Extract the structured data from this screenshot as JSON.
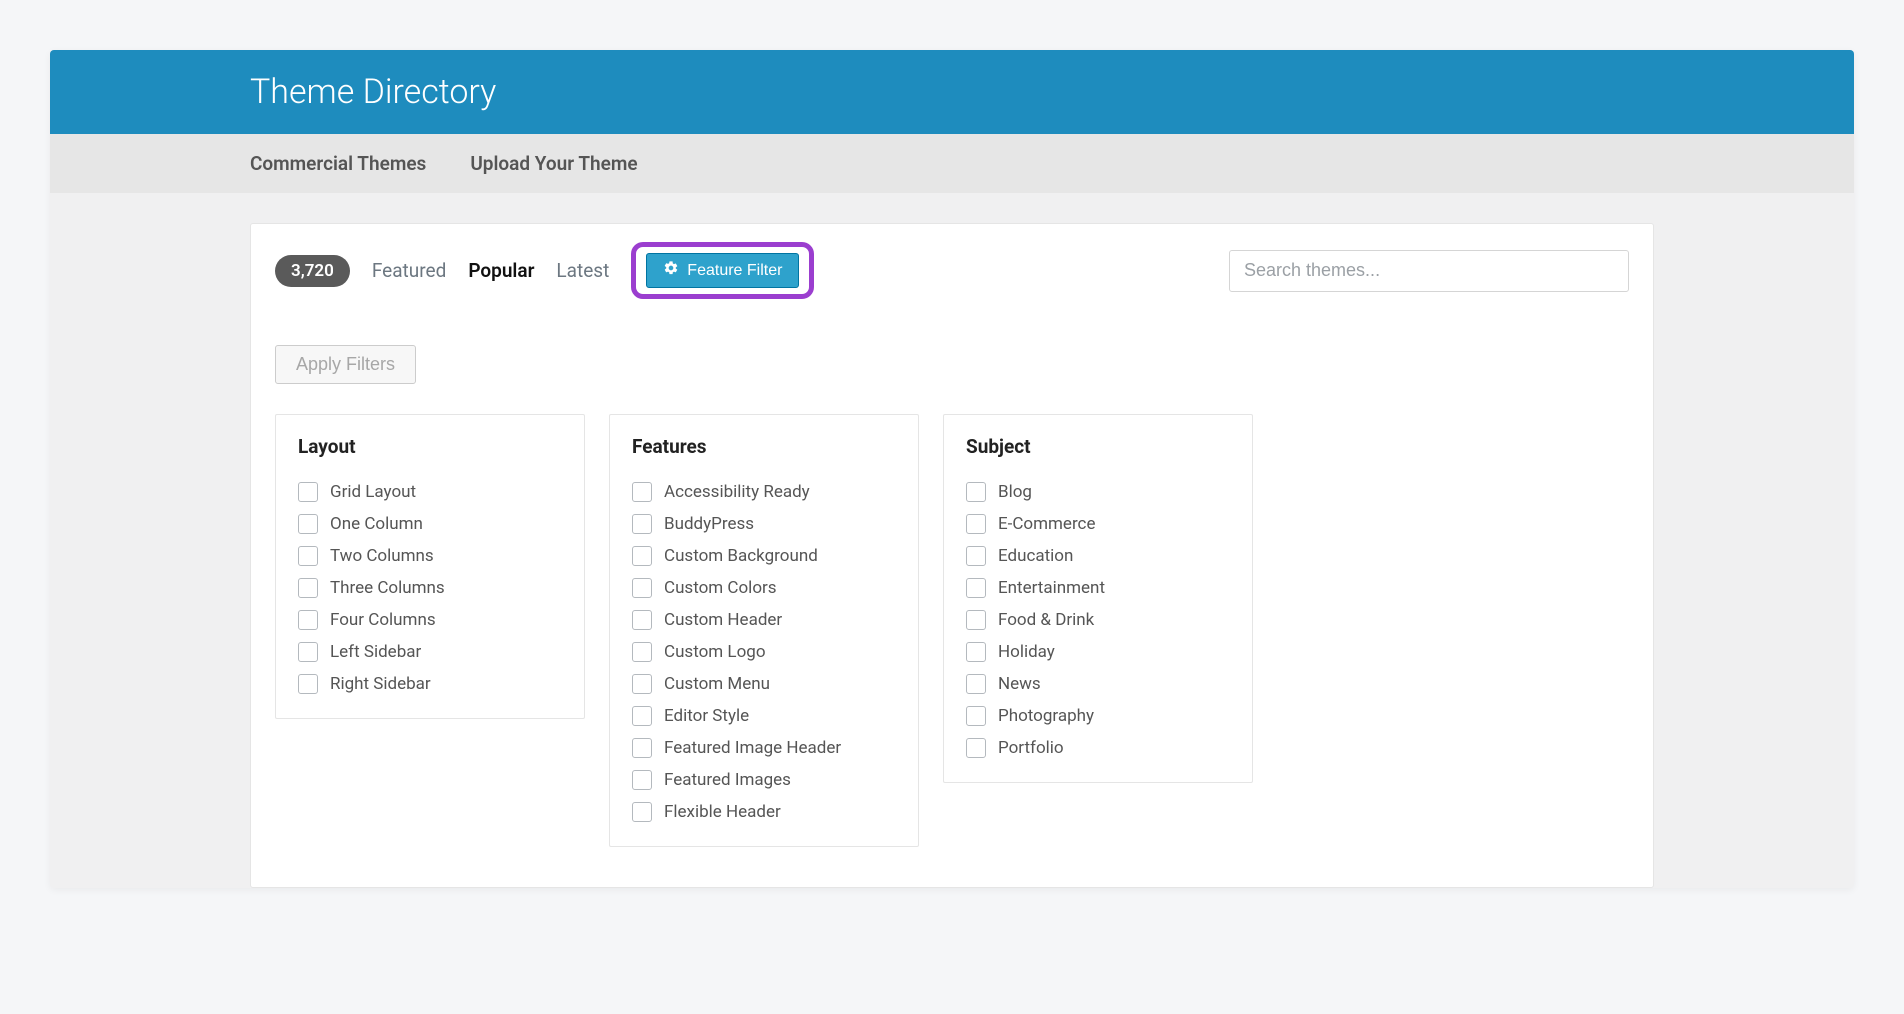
{
  "header": {
    "title": "Theme Directory"
  },
  "subnav": {
    "items": [
      "Commercial Themes",
      "Upload Your Theme"
    ]
  },
  "toolbar": {
    "count": "3,720",
    "tabs": [
      "Featured",
      "Popular",
      "Latest"
    ],
    "active_tab_index": 1,
    "feature_filter_label": "Feature Filter"
  },
  "search": {
    "placeholder": "Search themes..."
  },
  "apply_filters_label": "Apply Filters",
  "filter_columns": [
    {
      "title": "Layout",
      "items": [
        "Grid Layout",
        "One Column",
        "Two Columns",
        "Three Columns",
        "Four Columns",
        "Left Sidebar",
        "Right Sidebar"
      ]
    },
    {
      "title": "Features",
      "items": [
        "Accessibility Ready",
        "BuddyPress",
        "Custom Background",
        "Custom Colors",
        "Custom Header",
        "Custom Logo",
        "Custom Menu",
        "Editor Style",
        "Featured Image Header",
        "Featured Images",
        "Flexible Header"
      ]
    },
    {
      "title": "Subject",
      "items": [
        "Blog",
        "E-Commerce",
        "Education",
        "Entertainment",
        "Food & Drink",
        "Holiday",
        "News",
        "Photography",
        "Portfolio"
      ]
    }
  ]
}
